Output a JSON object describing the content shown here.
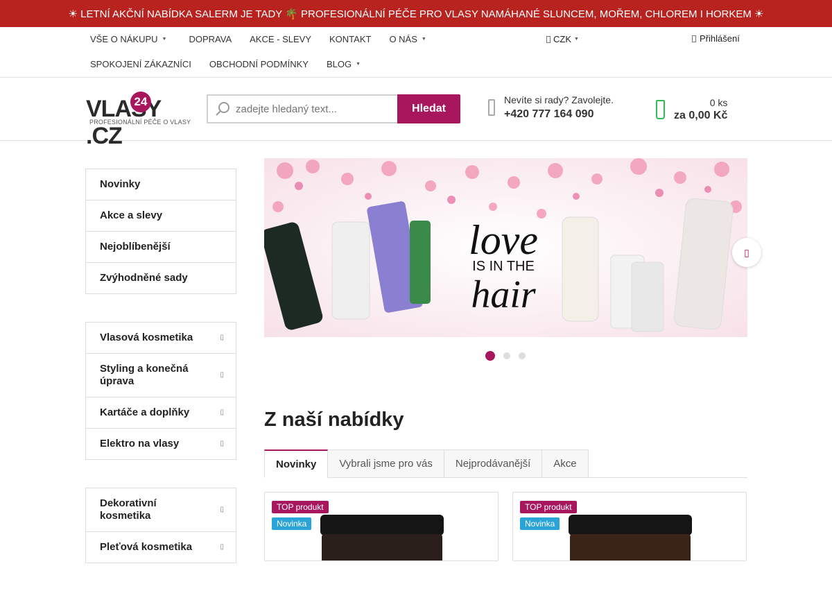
{
  "promo": {
    "text": "☀ LETNÍ AKČNÍ NABÍDKA SALERM JE TADY 🌴 PROFESIONÁLNÍ PÉČE PRO VLASY NAMÁHANÉ SLUNCEM, MOŘEM, CHLOREM I HORKEM ☀"
  },
  "topnav": {
    "row1": [
      {
        "label": "VŠE O NÁKUPU",
        "caret": true
      },
      {
        "label": "DOPRAVA",
        "caret": false
      },
      {
        "label": "AKCE - SLEVY",
        "caret": false
      },
      {
        "label": "KONTAKT",
        "caret": false
      },
      {
        "label": "O NÁS",
        "caret": true
      }
    ],
    "row2": [
      {
        "label": "SPOKOJENÍ ZÁKAZNÍCI",
        "caret": false
      },
      {
        "label": "OBCHODNÍ PODMÍNKY",
        "caret": false
      },
      {
        "label": "BLOG",
        "caret": true
      }
    ],
    "currency": "CZK",
    "login": "Přihlášení"
  },
  "header": {
    "logo_text": "VLASY",
    "logo_badge": "24",
    "logo_tld": ".CZ",
    "logo_sub": "PROFESIONÁLNÍ PÉČE O VLASY",
    "search_placeholder": "zadejte hledaný text...",
    "search_button": "Hledat",
    "contact_question": "Nevíte si rady? Zavolejte.",
    "contact_phone": "+420 777 164 090",
    "cart_count": "0 ks",
    "cart_sum": "za 0,00 Kč"
  },
  "sidebar": {
    "group1": [
      "Novinky",
      "Akce a slevy",
      "Nejoblíbenější",
      "Zvýhodněné sady"
    ],
    "group2": [
      "Vlasová kosmetika",
      "Styling a konečná úprava",
      "Kartáče a doplňky",
      "Elektro na vlasy"
    ],
    "group3": [
      "Dekorativní kosmetika",
      "Pleťová kosmetika"
    ]
  },
  "banner": {
    "headline_1": "love",
    "headline_2": "IS IN THE",
    "headline_3": "hair",
    "slides": 3,
    "active_slide": 1
  },
  "section": {
    "title": "Z naší nabídky",
    "tabs": [
      "Novinky",
      "Vybrali jsme pro vás",
      "Nejprodávanější",
      "Akce"
    ],
    "active_tab": 0
  },
  "products": [
    {
      "flag_top": "TOP produkt",
      "flag_new": "Novinka"
    },
    {
      "flag_top": "TOP produkt",
      "flag_new": "Novinka"
    }
  ],
  "colors": {
    "accent": "#a8165e",
    "promo_bg": "#b8231f",
    "cart": "#2dbf55",
    "new_flag": "#2aa3d8"
  }
}
